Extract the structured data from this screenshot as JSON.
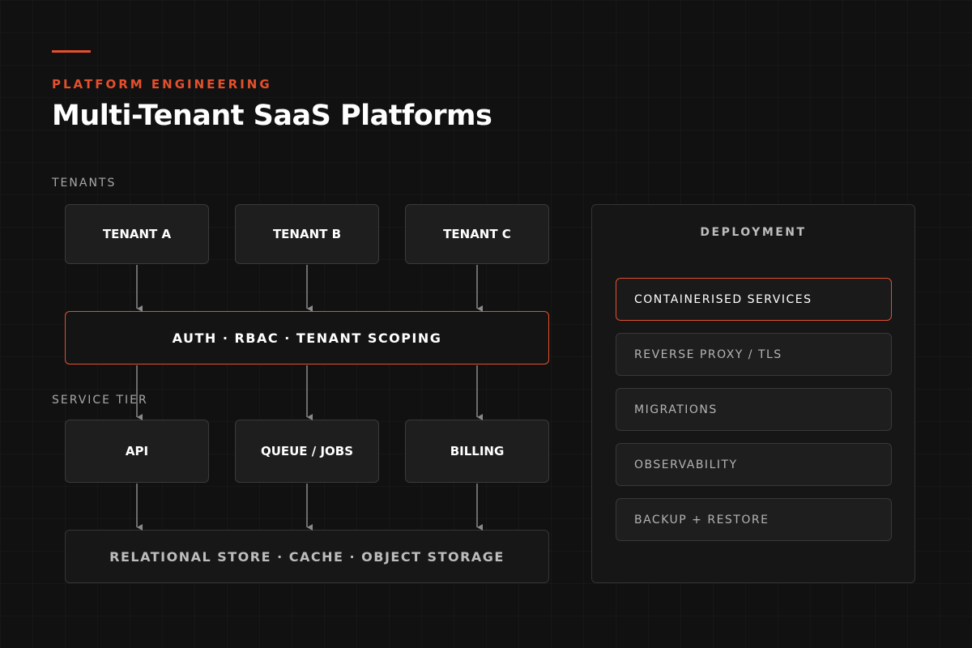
{
  "header": {
    "eyebrow": "PLATFORM ENGINEERING",
    "title": "Multi-Tenant SaaS Platforms"
  },
  "sections": {
    "tenants_label": "TENANTS",
    "service_tier_label": "SERVICE TIER"
  },
  "tenants": [
    "TENANT A",
    "TENANT B",
    "TENANT C"
  ],
  "auth_layer": "AUTH · RBAC · TENANT SCOPING",
  "services": [
    "API",
    "QUEUE / JOBS",
    "BILLING"
  ],
  "storage_layer": "RELATIONAL STORE · CACHE · OBJECT STORAGE",
  "deployment": {
    "title": "DEPLOYMENT",
    "items": [
      "CONTAINERISED SERVICES",
      "REVERSE PROXY / TLS",
      "MIGRATIONS",
      "OBSERVABILITY",
      "BACKUP + RESTORE"
    ],
    "highlighted_index": 0
  },
  "colors": {
    "background": "#111111",
    "accent": "#e4502d",
    "box_fill": "#1e1e1e",
    "box_border": "#3a3a3a",
    "arrow": "#8a8a8a"
  }
}
